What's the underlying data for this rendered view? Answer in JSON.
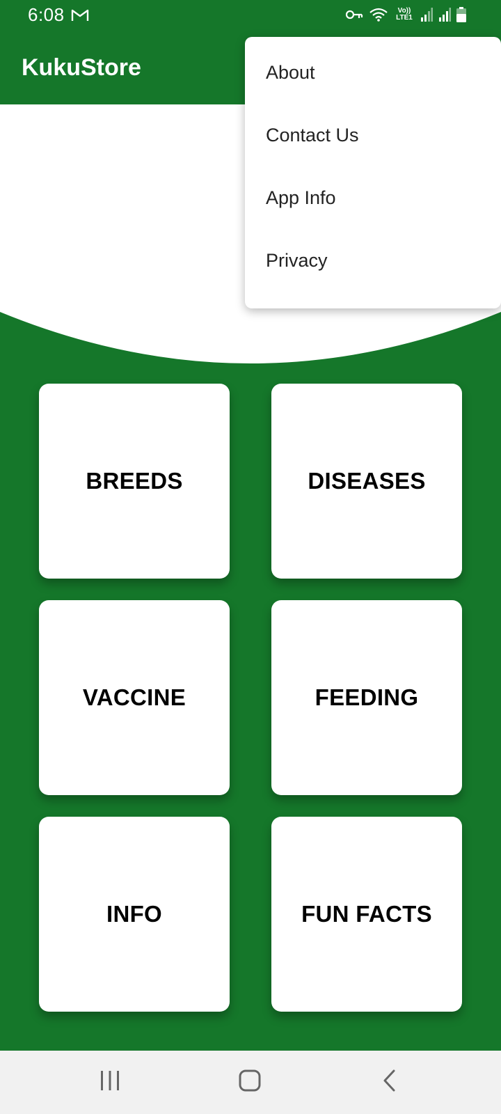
{
  "status_bar": {
    "time": "6:08",
    "volte_top": "Vo))",
    "volte_bottom": "LTE1",
    "icons": [
      "gmail-icon",
      "vpn-key-icon",
      "wifi-icon",
      "signal-icon",
      "signal-icon-2",
      "battery-icon"
    ]
  },
  "app_bar": {
    "title": "KukuStore"
  },
  "menu": {
    "items": [
      {
        "label": "About"
      },
      {
        "label": "Contact Us"
      },
      {
        "label": "App Info"
      },
      {
        "label": "Privacy"
      }
    ]
  },
  "cards": [
    {
      "label": "BREEDS"
    },
    {
      "label": "DISEASES"
    },
    {
      "label": "VACCINE"
    },
    {
      "label": "FEEDING"
    },
    {
      "label": "INFO"
    },
    {
      "label": "FUN FACTS"
    }
  ],
  "nav_bar": {
    "icons": [
      "recent-apps-icon",
      "home-icon",
      "back-icon"
    ]
  },
  "colors": {
    "primary": "#15772a",
    "surface": "#ffffff",
    "nav_background": "#f1f1f1"
  }
}
